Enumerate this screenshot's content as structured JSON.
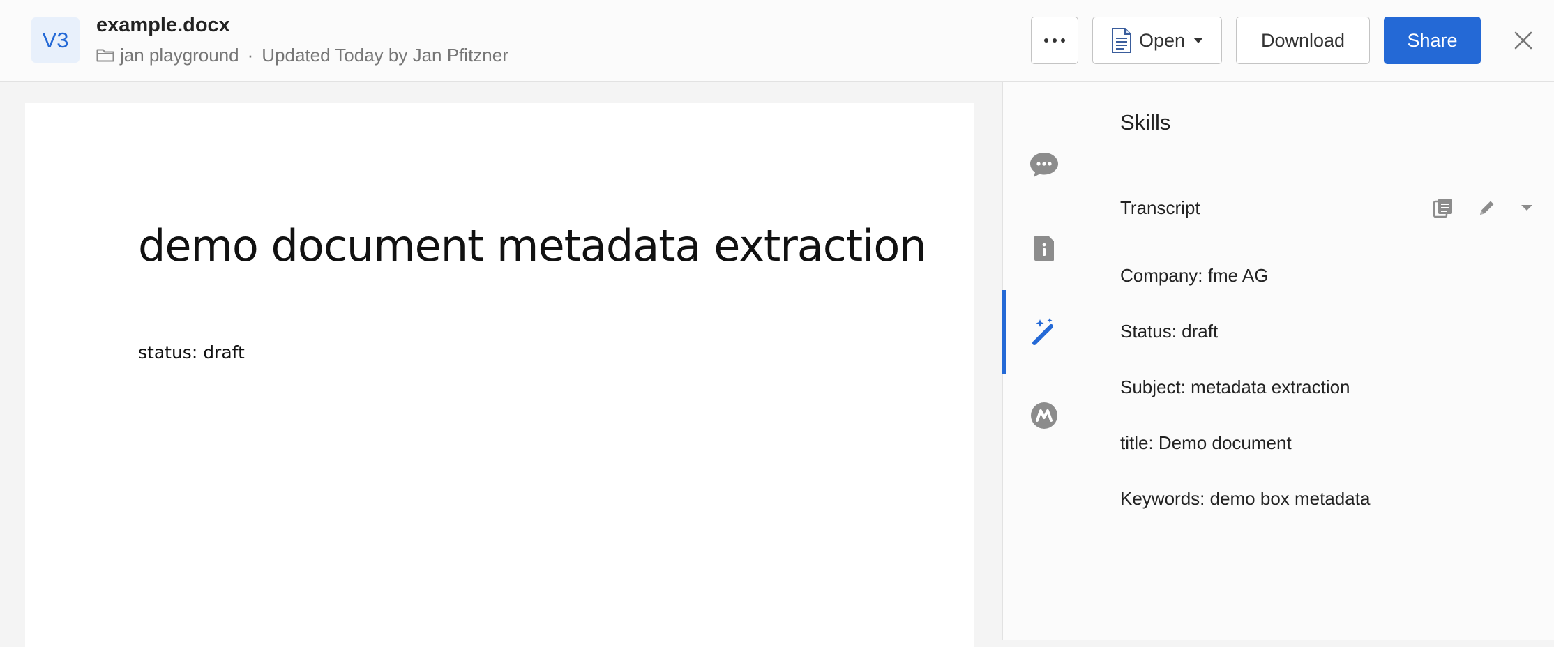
{
  "header": {
    "version": "V3",
    "file_name": "example.docx",
    "folder": "jan playground",
    "separator": "·",
    "updated": "Updated Today by Jan Pfitzner",
    "actions": {
      "more_icon": "ellipsis-icon",
      "open_label": "Open",
      "download_label": "Download",
      "share_label": "Share"
    },
    "close_icon": "close-icon",
    "colors": {
      "accent": "#2469d6",
      "badge_bg": "#e8f0fb"
    }
  },
  "document": {
    "title": "demo document metadata extraction",
    "body": "status: draft"
  },
  "rail": {
    "items": [
      {
        "icon": "comment-icon",
        "active": false
      },
      {
        "icon": "file-info-icon",
        "active": false
      },
      {
        "icon": "magic-wand-icon",
        "active": true
      },
      {
        "icon": "metadata-icon",
        "active": false
      }
    ]
  },
  "panel": {
    "title": "Skills",
    "card": {
      "title": "Transcript",
      "actions": [
        "copy-icon",
        "edit-icon",
        "chevron-down-icon"
      ],
      "entries": [
        "Company: fme AG",
        "Status: draft",
        "Subject: metadata extraction",
        "title: Demo document",
        "Keywords: demo box metadata"
      ]
    }
  }
}
